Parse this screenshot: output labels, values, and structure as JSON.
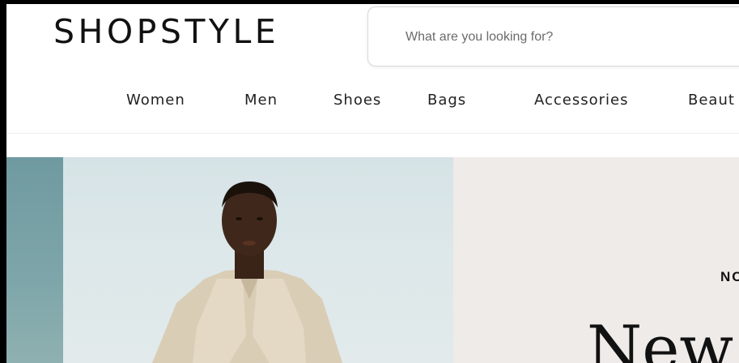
{
  "header": {
    "logo_text": "SHOPSTYLE",
    "search": {
      "placeholder": "What are you looking for?",
      "value": ""
    }
  },
  "nav": {
    "items": [
      {
        "label": "Women"
      },
      {
        "label": "Men"
      },
      {
        "label": "Shoes"
      },
      {
        "label": "Bags"
      },
      {
        "label": "Accessories"
      },
      {
        "label": "Beaut"
      }
    ]
  },
  "hero": {
    "eyebrow": "NC",
    "headline": "New",
    "colors": {
      "panel_background": "#efebe8",
      "image_background": "#dde8ea",
      "left_strip": "#7ea6aa"
    }
  }
}
